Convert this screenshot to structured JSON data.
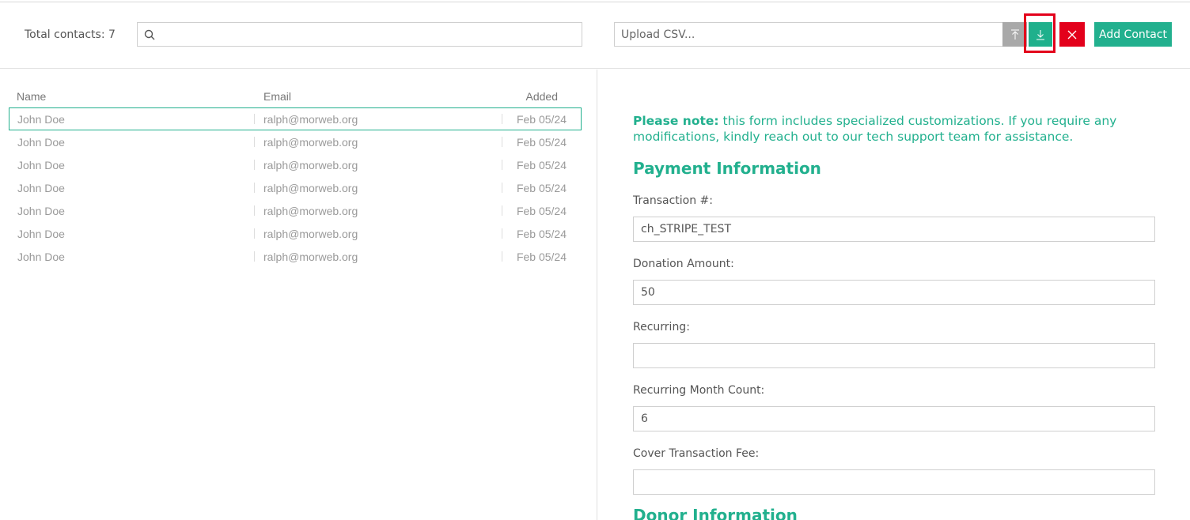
{
  "toolbar": {
    "total_contacts": "Total contacts: 7",
    "search": {
      "value": "",
      "placeholder": ""
    },
    "upload_placeholder": "Upload CSV...",
    "add_contact_label": "Add Contact"
  },
  "contacts": {
    "columns": {
      "name": "Name",
      "email": "Email",
      "added": "Added"
    },
    "rows": [
      {
        "name": "John Doe",
        "email": "ralph@morweb.org",
        "added": "Feb 05/24"
      },
      {
        "name": "John Doe",
        "email": "ralph@morweb.org",
        "added": "Feb 05/24"
      },
      {
        "name": "John Doe",
        "email": "ralph@morweb.org",
        "added": "Feb 05/24"
      },
      {
        "name": "John Doe",
        "email": "ralph@morweb.org",
        "added": "Feb 05/24"
      },
      {
        "name": "John Doe",
        "email": "ralph@morweb.org",
        "added": "Feb 05/24"
      },
      {
        "name": "John Doe",
        "email": "ralph@morweb.org",
        "added": "Feb 05/24"
      },
      {
        "name": "John Doe",
        "email": "ralph@morweb.org",
        "added": "Feb 05/24"
      }
    ]
  },
  "form": {
    "note_bold": "Please note:",
    "note_text": " this form includes specialized customizations. If you require any modifications, kindly reach out to our tech support team for assistance.",
    "payment_heading": "Payment Information",
    "fields": [
      {
        "label": "Transaction #:",
        "value": "ch_STRIPE_TEST"
      },
      {
        "label": "Donation Amount:",
        "value": "50"
      },
      {
        "label": "Recurring:",
        "value": ""
      },
      {
        "label": "Recurring Month Count:",
        "value": "6"
      },
      {
        "label": "Cover Transaction Fee:",
        "value": ""
      }
    ],
    "donor_heading": "Donor Information"
  },
  "icons": {
    "search": "search-icon",
    "upload": "upload-arrow-icon",
    "download": "download-arrow-icon",
    "clear": "close-icon"
  },
  "colors": {
    "accent": "#22b08e",
    "danger": "#e3001b",
    "disabled": "#a9a9a9"
  }
}
